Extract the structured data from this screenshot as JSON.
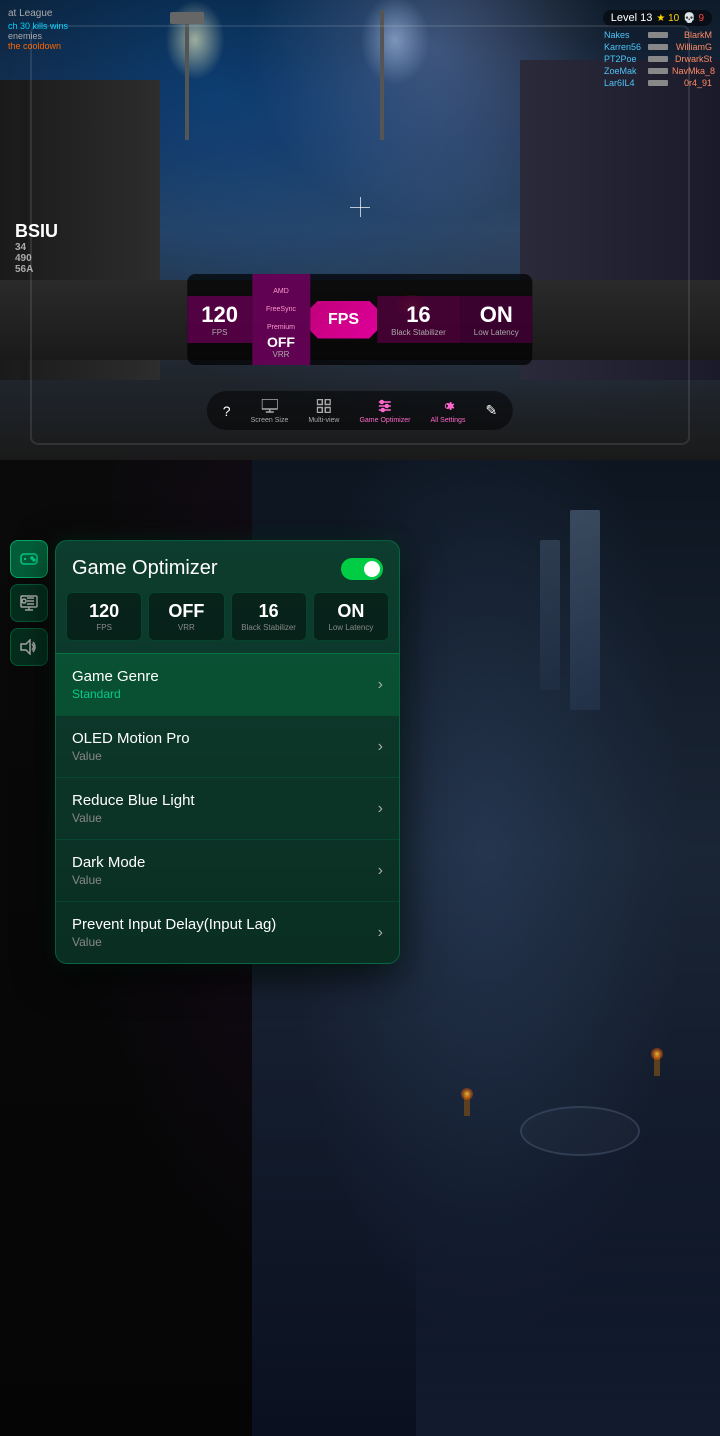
{
  "top": {
    "hud": {
      "match_name": "at League",
      "kill_info": "ch 30 kills wins",
      "enemies": "enemies",
      "cooldown": "the cooldown",
      "level": "Level 13",
      "star_count": "10",
      "skull_count": "9"
    },
    "scoreboard": {
      "rows": [
        {
          "team1": "Nakes",
          "team2": "BlarkM"
        },
        {
          "team1": "Karren56",
          "team2": "WilliamG"
        },
        {
          "team1": "PT2Poe",
          "team2": "DrwarkSt"
        },
        {
          "team1": "ZoeMak",
          "team2": "NavMka_8"
        },
        {
          "team1": "Lar6IL4",
          "team2": "0r4_91"
        }
      ]
    },
    "bsiu": "BSIU",
    "stats": {
      "fps_value": "120",
      "fps_label": "FPS",
      "freesync_label": "AMD FreeSync Premium",
      "vrr_value": "OFF",
      "vrr_label": "VRR",
      "mode_active": "FPS",
      "bs_value": "16",
      "bs_label": "Black Stabilizer",
      "latency_value": "ON",
      "latency_label": "Low Latency"
    },
    "nav": {
      "help": "?",
      "screen_size_label": "Screen Size",
      "screen_size_icon": "monitor",
      "multiview_label": "Multi-view",
      "multiview_icon": "grid",
      "optimizer_label": "Game Optimizer",
      "optimizer_icon": "sliders",
      "settings_label": "All Settings",
      "settings_icon": "gear",
      "edit_icon": "pencil"
    }
  },
  "optimizer": {
    "title": "Game Optimizer",
    "toggle_state": "on",
    "stats": [
      {
        "value": "120",
        "label": "FPS"
      },
      {
        "value": "OFF",
        "label": "VRR"
      },
      {
        "value": "16",
        "label": "Black Stabilizer"
      },
      {
        "value": "ON",
        "label": "Low Latency"
      }
    ],
    "menu_items": [
      {
        "title": "Game Genre",
        "subtitle": "Standard",
        "highlighted": true
      },
      {
        "title": "OLED Motion Pro",
        "subtitle": "Value",
        "highlighted": false
      },
      {
        "title": "Reduce Blue Light",
        "subtitle": "Value",
        "highlighted": false
      },
      {
        "title": "Dark Mode",
        "subtitle": "Value",
        "highlighted": false
      },
      {
        "title": "Prevent Input Delay(Input Lag)",
        "subtitle": "Value",
        "highlighted": false
      }
    ]
  },
  "side_icons": [
    {
      "icon": "gamepad",
      "active": true
    },
    {
      "icon": "snowflake",
      "active": false
    },
    {
      "icon": "volume",
      "active": false
    }
  ]
}
